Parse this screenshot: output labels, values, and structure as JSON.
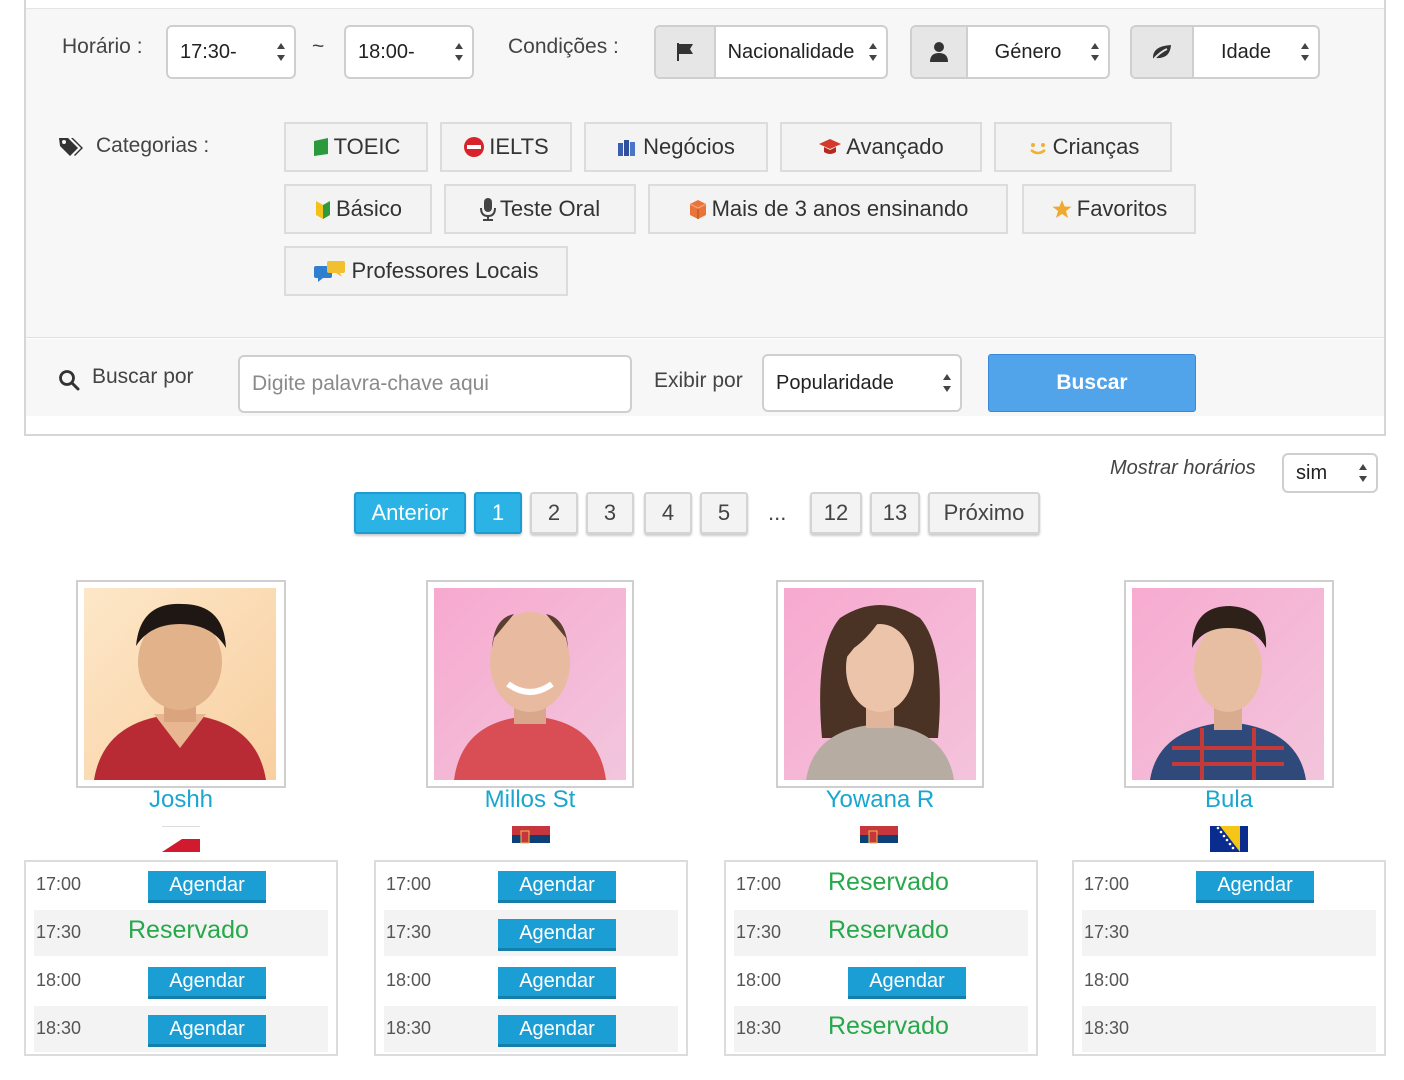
{
  "filters": {
    "horario_label": "Horário :",
    "time_from": "17:30-",
    "tilde": "~",
    "time_to": "18:00-",
    "condicoes_label": "Condições :",
    "nacionalidade": "Nacionalidade",
    "genero": "Género",
    "idade": "Idade"
  },
  "categories": {
    "label": "Categorias :",
    "items": [
      "TOEIC",
      "IELTS",
      "Negócios",
      "Avançado",
      "Crianças",
      "Básico",
      "Teste Oral",
      "Mais de 3 anos ensinando",
      "Favoritos",
      "Professores Locais"
    ]
  },
  "search": {
    "label": "Buscar por",
    "placeholder": "Digite palavra-chave aqui",
    "exibir_label": "Exibir por",
    "sort_value": "Popularidade",
    "button": "Buscar"
  },
  "display": {
    "mostrar_label": "Mostrar horários",
    "mostrar_value": "sim"
  },
  "pagination": {
    "prev": "Anterior",
    "pages": [
      "1",
      "2",
      "3",
      "4",
      "5",
      "12",
      "13"
    ],
    "ellipsis": "...",
    "next": "Próximo",
    "current": "1"
  },
  "slot_labels": {
    "book": "Agendar",
    "reserved": "Reservado"
  },
  "teachers": [
    {
      "name": "Joshh",
      "flag_icon": "philippines-flag-icon",
      "slots": [
        {
          "time": "17:00",
          "status": "Agendar"
        },
        {
          "time": "17:30",
          "status": "Reservado"
        },
        {
          "time": "18:00",
          "status": "Agendar"
        },
        {
          "time": "18:30",
          "status": "Agendar"
        }
      ]
    },
    {
      "name": "Millos St",
      "flag_icon": "serbia-flag-icon",
      "slots": [
        {
          "time": "17:00",
          "status": "Agendar"
        },
        {
          "time": "17:30",
          "status": "Agendar"
        },
        {
          "time": "18:00",
          "status": "Agendar"
        },
        {
          "time": "18:30",
          "status": "Agendar"
        }
      ]
    },
    {
      "name": "Yowana R",
      "flag_icon": "serbia-flag-icon",
      "slots": [
        {
          "time": "17:00",
          "status": "Reservado"
        },
        {
          "time": "17:30",
          "status": "Reservado"
        },
        {
          "time": "18:00",
          "status": "Agendar"
        },
        {
          "time": "18:30",
          "status": "Reservado"
        }
      ]
    },
    {
      "name": "Bula",
      "flag_icon": "bosnia-flag-icon",
      "slots": [
        {
          "time": "17:00",
          "status": "Agendar"
        },
        {
          "time": "17:30",
          "status": ""
        },
        {
          "time": "18:00",
          "status": ""
        },
        {
          "time": "18:30",
          "status": ""
        }
      ]
    }
  ],
  "colors": {
    "accent_blue": "#52a4ea",
    "page_blue": "#2bb3e6",
    "name_teal": "#1aa6cf",
    "book_button": "#1a9ed4",
    "reserved_green": "#27a84a"
  }
}
